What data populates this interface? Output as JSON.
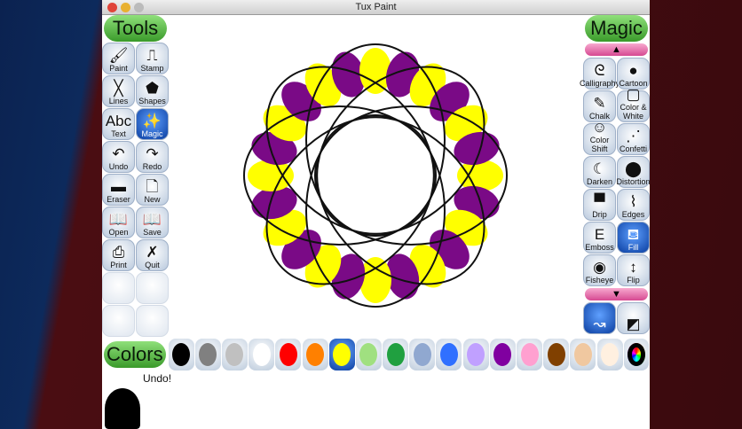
{
  "window": {
    "title": "Tux Paint"
  },
  "tools": {
    "header": "Tools",
    "items": [
      {
        "label": "Paint",
        "icon": "paintbrush-icon",
        "glyph": "🖌"
      },
      {
        "label": "Stamp",
        "icon": "stamp-icon",
        "glyph": "⎍"
      },
      {
        "label": "Lines",
        "icon": "lines-icon",
        "glyph": "╳"
      },
      {
        "label": "Shapes",
        "icon": "pentagon-icon",
        "glyph": "⬟"
      },
      {
        "label": "Text",
        "icon": "text-icon",
        "glyph": "Abc"
      },
      {
        "label": "Magic",
        "icon": "magic-wand-icon",
        "glyph": "✨",
        "selected": true
      },
      {
        "label": "Undo",
        "icon": "undo-icon",
        "glyph": "↶"
      },
      {
        "label": "Redo",
        "icon": "redo-icon",
        "glyph": "↷"
      },
      {
        "label": "Eraser",
        "icon": "eraser-icon",
        "glyph": "▬"
      },
      {
        "label": "New",
        "icon": "new-icon",
        "glyph": "🗋"
      },
      {
        "label": "Open",
        "icon": "open-icon",
        "glyph": "📖"
      },
      {
        "label": "Save",
        "icon": "save-icon",
        "glyph": "📖"
      },
      {
        "label": "Print",
        "icon": "print-icon",
        "glyph": "⎙"
      },
      {
        "label": "Quit",
        "icon": "quit-icon",
        "glyph": "✗"
      }
    ]
  },
  "magic": {
    "header": "Magic",
    "items": [
      {
        "label": "Calligraphy",
        "icon": "calligraphy-icon",
        "glyph": "ᘓ"
      },
      {
        "label": "Cartoon",
        "icon": "cartoon-icon",
        "glyph": "●"
      },
      {
        "label": "Chalk",
        "icon": "chalk-icon",
        "glyph": "✎"
      },
      {
        "label": "Color & White",
        "icon": "color-white-icon",
        "glyph": "▢"
      },
      {
        "label": "Color Shift",
        "icon": "color-shift-icon",
        "glyph": "☺"
      },
      {
        "label": "Confetti",
        "icon": "confetti-icon",
        "glyph": "⋰"
      },
      {
        "label": "Darken",
        "icon": "darken-icon",
        "glyph": "☾"
      },
      {
        "label": "Distortion",
        "icon": "distortion-icon",
        "glyph": "⬤"
      },
      {
        "label": "Drip",
        "icon": "drip-icon",
        "glyph": "▀"
      },
      {
        "label": "Edges",
        "icon": "edges-icon",
        "glyph": "⌇"
      },
      {
        "label": "Emboss",
        "icon": "emboss-icon",
        "glyph": "E"
      },
      {
        "label": "Fill",
        "icon": "fill-bucket-icon",
        "glyph": "⛾",
        "selected": true
      },
      {
        "label": "Fisheye",
        "icon": "fisheye-icon",
        "glyph": "◉"
      },
      {
        "label": "Flip",
        "icon": "flip-icon",
        "glyph": "↕"
      }
    ]
  },
  "colors": {
    "header": "Colors",
    "selected_index": 6,
    "swatches": [
      "#000000",
      "#808080",
      "#c0c0c0",
      "#ffffff",
      "#ff0000",
      "#ff8000",
      "#ffff00",
      "#a0e080",
      "#20a040",
      "#90a8d0",
      "#3070ff",
      "#c0a0ff",
      "#8000a0",
      "#ffa0d0",
      "#804000",
      "#f0c8a0",
      "#fff0e0"
    ]
  },
  "status": {
    "message": "Undo!"
  },
  "palette": {
    "yellow": "#ffff00",
    "purple": "#7a0a86"
  }
}
